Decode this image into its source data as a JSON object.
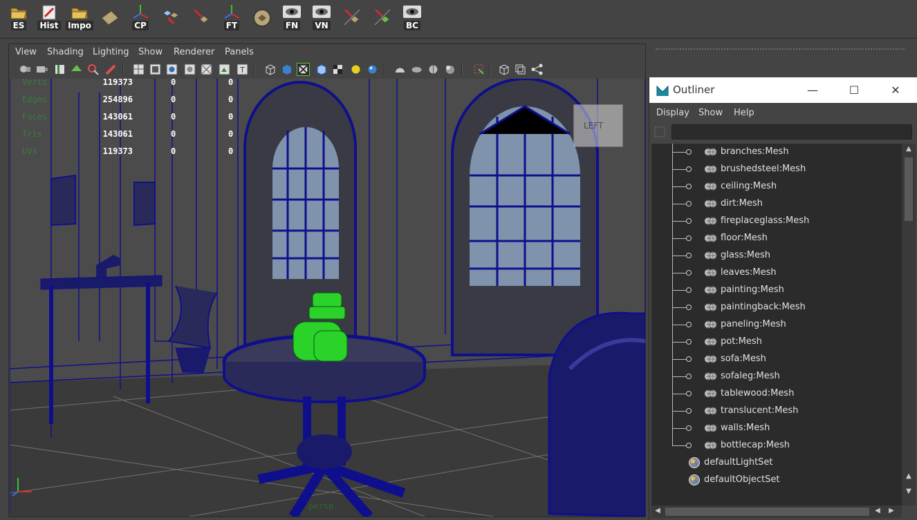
{
  "shelf": {
    "buttons": [
      {
        "label": "ES",
        "icon": "folder-open-icon"
      },
      {
        "label": "Hist",
        "icon": "history-icon"
      },
      {
        "label": "Impo",
        "icon": "import-folder-icon"
      },
      {
        "label": "",
        "icon": "plane-icon"
      },
      {
        "label": "CP",
        "icon": "center-pivot-icon"
      },
      {
        "label": "",
        "icon": "snap-icon"
      },
      {
        "label": "",
        "icon": "tool-icon"
      },
      {
        "label": "FT",
        "icon": "freeze-transform-icon"
      },
      {
        "label": "",
        "icon": "sphere-grid-icon"
      },
      {
        "label": "FN",
        "icon": "eye-normals-icon"
      },
      {
        "label": "VN",
        "icon": "eye-vertex-icon"
      },
      {
        "label": "",
        "icon": "paint-tool-icon"
      },
      {
        "label": "",
        "icon": "brush-tool-icon"
      },
      {
        "label": "BC",
        "icon": "eye-bc-icon"
      }
    ]
  },
  "panel": {
    "menu": [
      "View",
      "Shading",
      "Lighting",
      "Show",
      "Renderer",
      "Panels"
    ]
  },
  "hud": {
    "rows": [
      {
        "key": "Verts",
        "value": "119373",
        "a": "0",
        "b": "0"
      },
      {
        "key": "Edges",
        "value": "254896",
        "a": "0",
        "b": "0"
      },
      {
        "key": "Faces",
        "value": "143061",
        "a": "0",
        "b": "0"
      },
      {
        "key": "Tris",
        "value": "143061",
        "a": "0",
        "b": "0"
      },
      {
        "key": "UVs",
        "value": "119373",
        "a": "0",
        "b": "0"
      }
    ],
    "view_cube_label": "LEFT",
    "camera_label": "persp"
  },
  "outliner": {
    "title": "Outliner",
    "menu": [
      "Display",
      "Show",
      "Help"
    ],
    "search_value": "",
    "children": [
      "branches:Mesh",
      "brushedsteel:Mesh",
      "ceiling:Mesh",
      "dirt:Mesh",
      "fireplaceglass:Mesh",
      "floor:Mesh",
      "glass:Mesh",
      "leaves:Mesh",
      "painting:Mesh",
      "paintingback:Mesh",
      "paneling:Mesh",
      "pot:Mesh",
      "sofa:Mesh",
      "sofaleg:Mesh",
      "tablewood:Mesh",
      "translucent:Mesh",
      "walls:Mesh",
      "bottlecap:Mesh"
    ],
    "sets": [
      "defaultLightSet",
      "defaultObjectSet"
    ]
  },
  "colors": {
    "wire": "#0f0f8c",
    "selected": "#22dd22",
    "background": "#444444"
  }
}
